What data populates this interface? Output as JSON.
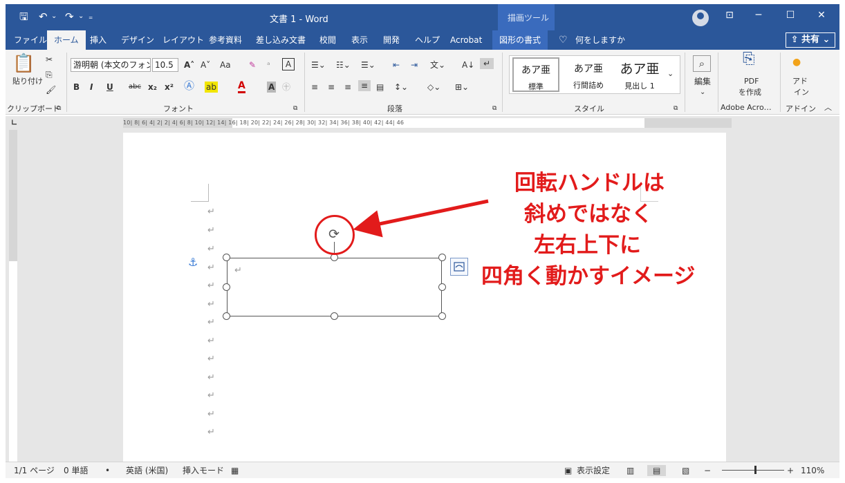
{
  "titlebar": {
    "save_icon": "save-icon",
    "undo_icon": "undo-icon",
    "redo_icon": "redo-icon",
    "doc_title": "文書 1 - Word",
    "context_tool_label": "描画ツール",
    "share_label": "共有",
    "bg_color": "#2b579a"
  },
  "tabs": [
    {
      "label": "ファイル"
    },
    {
      "label": "ホーム"
    },
    {
      "label": "挿入"
    },
    {
      "label": "デザイン"
    },
    {
      "label": "レイアウト"
    },
    {
      "label": "参考資料"
    },
    {
      "label": "差し込み文書"
    },
    {
      "label": "校閲"
    },
    {
      "label": "表示"
    },
    {
      "label": "開発"
    },
    {
      "label": "ヘルプ"
    },
    {
      "label": "Acrobat"
    },
    {
      "label": "図形の書式"
    }
  ],
  "tell_me": "何をしますか",
  "ribbon": {
    "clipboard": {
      "paste_label": "貼り付け",
      "group_label": "クリップボード"
    },
    "font": {
      "font_name": "游明朝 (本文のフォン",
      "font_size": "10.5",
      "change_case": "Aa",
      "group_label": "フォント"
    },
    "paragraph": {
      "group_label": "段落"
    },
    "styles": {
      "items": [
        {
          "preview": "あア亜",
          "name": "標準"
        },
        {
          "preview": "あア亜",
          "name": "行間詰め"
        },
        {
          "preview": "あア亜",
          "name": "見出し 1"
        }
      ],
      "group_label": "スタイル"
    },
    "editing": {
      "label": "編集"
    },
    "adobe": {
      "button_label_1": "PDF",
      "button_label_2": "を作成",
      "group_label": "Adobe Acro…"
    },
    "addins": {
      "button_label_1": "アド",
      "button_label_2": "イン",
      "group_label": "アドイン"
    }
  },
  "ruler_scale": "10|  8|  6|  4|  2|     2|  4|  6|  8| 10| 12| 14| 16| 18|  20| 22| 24| 26| 28| 30| 32| 34| 36| 38| 40| 42| 44| 46",
  "document": {
    "para_mark": "↵",
    "anchor_icon": "anchor-icon",
    "rotation_icon": "rotation-handle-icon"
  },
  "callout": {
    "color": "#e21b1b",
    "lines": [
      "回転ハンドルは",
      "斜めではなく",
      "左右上下に",
      "四角く動かすイメージ"
    ]
  },
  "statusbar": {
    "page": "1/1 ページ",
    "words": "0 単語",
    "language": "英語 (米国)",
    "mode": "挿入モード",
    "display_settings": "表示設定",
    "zoom_minus": "−",
    "zoom_plus": "+",
    "zoom": "110%",
    "zoom_level_percent": 110
  }
}
